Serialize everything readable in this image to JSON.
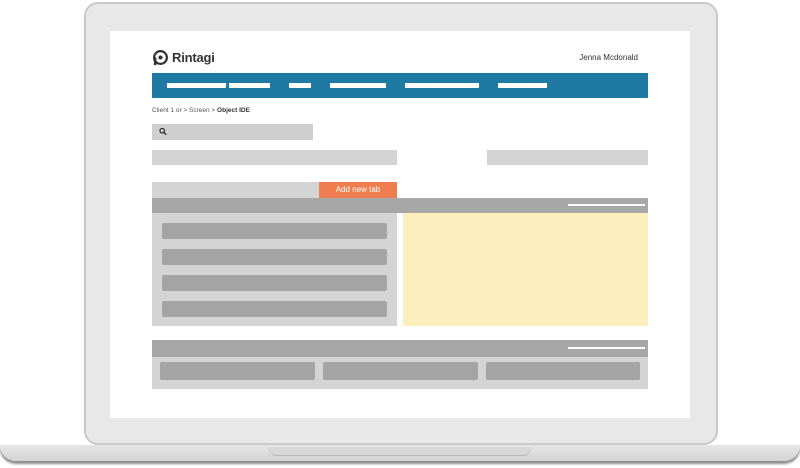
{
  "app": {
    "brand": "Rintagi",
    "user_name": "Jenna Mcdonald"
  },
  "breadcrumb": {
    "path": "Client 1 or > Screen > ",
    "current": "Object IDE"
  },
  "tabs": {
    "add_label": "Add new tab"
  },
  "colors": {
    "nav": "#1e7aa2",
    "accent": "#ef7d4f",
    "detail_panel": "#fdefbd"
  },
  "icons": {
    "logo": "rintagi-logo-icon",
    "search": "search-icon"
  }
}
